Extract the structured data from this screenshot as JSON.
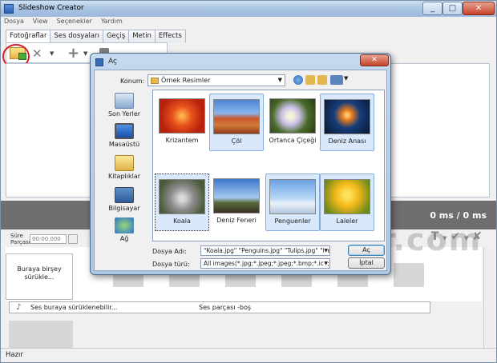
{
  "window": {
    "title": "Slideshow Creator"
  },
  "menu": [
    "Dosya",
    "View",
    "Seçenekler",
    "Yardım"
  ],
  "tabs": [
    "Fotoğraflar",
    "Ses dosyaları",
    "Geçiş",
    "Metin",
    "Effects"
  ],
  "preview": {
    "time": "0 ms / 0 ms"
  },
  "duration": {
    "label": "Süre Parçası",
    "value": "00:00.000"
  },
  "dropzone": {
    "text": "Buraya birşey sürükle..."
  },
  "audio": {
    "drop_text": "Ses buraya sürüklenebilir...",
    "status": "Ses parçası -boş"
  },
  "watermark": "www.programlar.com",
  "statusbar": {
    "text": "Hazır"
  },
  "dialog": {
    "title": "Aç",
    "location_label": "Konum:",
    "location_value": "Örnek Resimler",
    "places": [
      "Son Yerler",
      "Masaüstü",
      "Kitaplıklar",
      "Bilgisayar",
      "Ağ"
    ],
    "files": [
      {
        "name": "Krizantem",
        "selected": false
      },
      {
        "name": "Çöl",
        "selected": true
      },
      {
        "name": "Ortanca Çiçeği",
        "selected": false
      },
      {
        "name": "Deniz Anası",
        "selected": true
      },
      {
        "name": "Koala",
        "selected": true
      },
      {
        "name": "Deniz Feneri",
        "selected": false
      },
      {
        "name": "Penguenler",
        "selected": true
      },
      {
        "name": "Laleler",
        "selected": true
      }
    ],
    "filename_label": "Dosya Adı:",
    "filename_value": "\"Koala.jpg\" \"Penguins.jpg\" \"Tulips.jpg\" \"Deser",
    "filetype_label": "Dosya türü:",
    "filetype_value": "All images(*.jpg;*.jpeg;*.jpeg;*.bmp;*.ico;*.e",
    "open_button": "Aç",
    "cancel_button": "İptal"
  },
  "icons": [
    "app-icon",
    "open-folder-icon",
    "delete-icon",
    "add-icon",
    "square-icon",
    "text-icon",
    "check-icon",
    "magic-icon",
    "music-note-icon"
  ],
  "colors": {
    "highlight": "#d0202c",
    "preview_bg": "#6e6e6e",
    "dialog_frame": "#aec7e3",
    "selection": "#d9e8fb"
  }
}
